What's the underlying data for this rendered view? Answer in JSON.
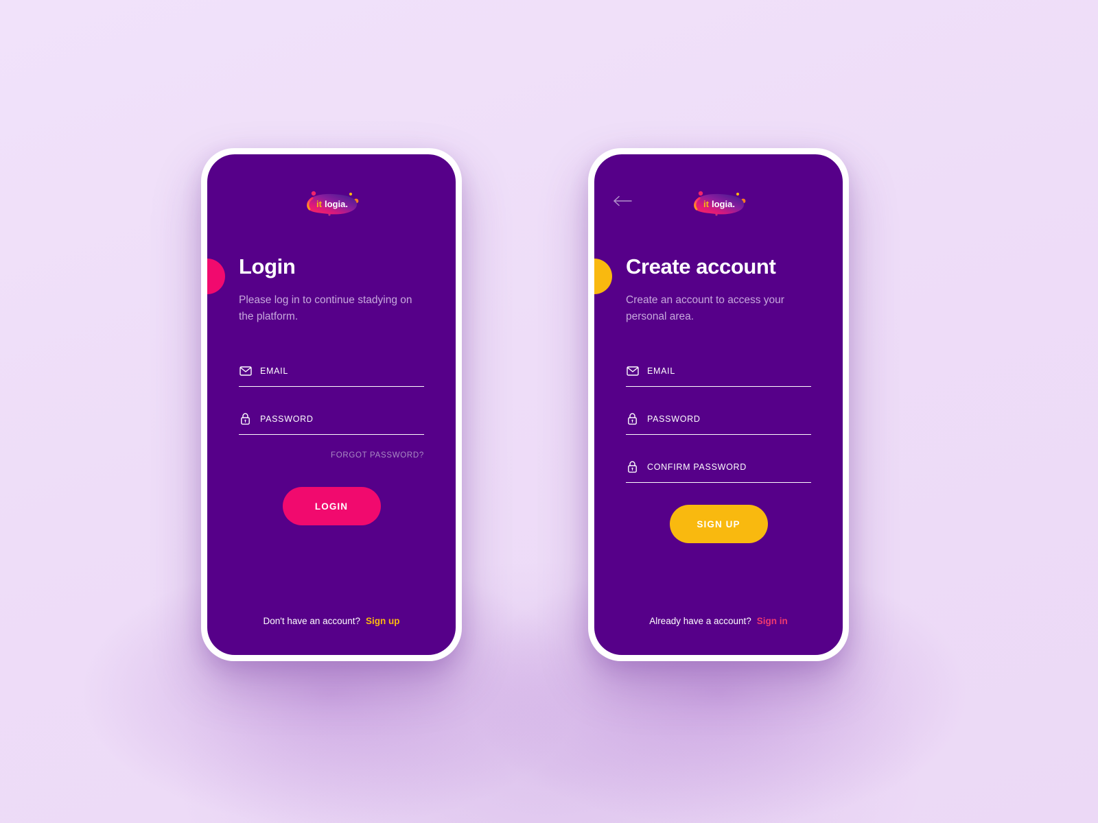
{
  "theme": {
    "background": "#efdff8",
    "screen_bg": "#560089",
    "accent_pink": "#f10a6e",
    "accent_amber": "#f9b90f",
    "text_muted": "#c7a8dd",
    "text_light": "#ffffff"
  },
  "brand": {
    "name_first": "it",
    "name_rest": "logia.",
    "logo_icon": "itlogia-blob-logo"
  },
  "login_screen": {
    "title": "Login",
    "subtitle": "Please log in to continue stadying on the platform.",
    "fields": [
      {
        "label": "EMAIL",
        "placeholder": "EMAIL",
        "value": "",
        "icon": "envelope-icon",
        "type": "email"
      },
      {
        "label": "PASSWORD",
        "placeholder": "PASSWORD",
        "value": "",
        "icon": "lock-icon",
        "type": "password"
      }
    ],
    "forgot_password": "FORGOT PASSWORD?",
    "submit_label": "LOGIN",
    "footer_text": "Don't have an account?",
    "footer_link": "Sign up"
  },
  "signup_screen": {
    "back_icon": "arrow-left-icon",
    "title": "Create account",
    "subtitle": "Create an account to access your personal area.",
    "fields": [
      {
        "label": "EMAIL",
        "placeholder": "EMAIL",
        "value": "",
        "icon": "envelope-icon",
        "type": "email"
      },
      {
        "label": "PASSWORD",
        "placeholder": "PASSWORD",
        "value": "",
        "icon": "lock-icon",
        "type": "password"
      },
      {
        "label": "CONFIRM PASSWORD",
        "placeholder": "CONFIRM PASSWORD",
        "value": "",
        "icon": "lock-icon",
        "type": "password"
      }
    ],
    "submit_label": "SIGN UP",
    "footer_text": "Already have a account?",
    "footer_link": "Sign in"
  }
}
